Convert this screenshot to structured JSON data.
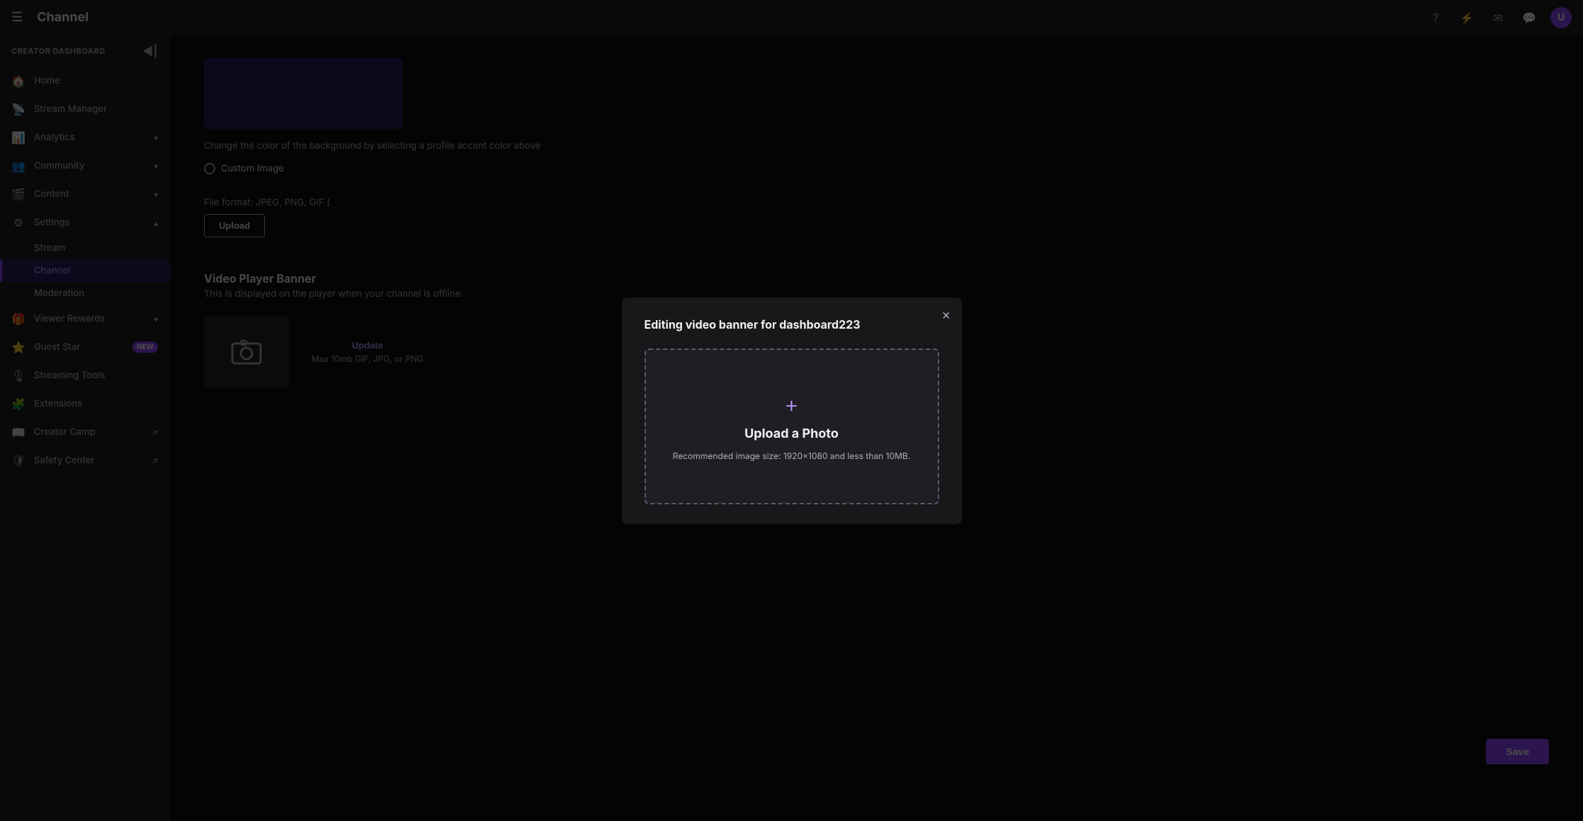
{
  "topNav": {
    "hamburger": "☰",
    "title": "Channel",
    "icons": [
      "?",
      "⚡",
      "✉",
      "💬"
    ],
    "avatarText": "U"
  },
  "sidebar": {
    "header": "CREATOR DASHBOARD",
    "collapseIcon": "◀|",
    "items": [
      {
        "id": "home",
        "label": "Home",
        "icon": "🏠",
        "hasChevron": false,
        "isActive": false
      },
      {
        "id": "stream-manager",
        "label": "Stream Manager",
        "icon": "📡",
        "hasChevron": false,
        "isActive": false
      },
      {
        "id": "analytics",
        "label": "Analytics",
        "icon": "📊",
        "hasChevron": true,
        "isActive": false
      },
      {
        "id": "community",
        "label": "Community",
        "icon": "👥",
        "hasChevron": true,
        "isActive": false
      },
      {
        "id": "content",
        "label": "Content",
        "icon": "🎬",
        "hasChevron": true,
        "isActive": false
      },
      {
        "id": "settings",
        "label": "Settings",
        "icon": "⚙",
        "hasChevron": true,
        "isActive": false,
        "isOpen": true
      }
    ],
    "subItems": [
      {
        "id": "stream",
        "label": "Stream",
        "isActive": false
      },
      {
        "id": "channel",
        "label": "Channel",
        "isActive": true
      },
      {
        "id": "moderation",
        "label": "Moderation",
        "isActive": false
      }
    ],
    "bottomItems": [
      {
        "id": "viewer-rewards",
        "label": "Viewer Rewards",
        "icon": "🎁",
        "hasChevron": true,
        "isActive": false
      },
      {
        "id": "guest-star",
        "label": "Guest Star",
        "icon": "⭐",
        "hasChevron": false,
        "badge": "NEW",
        "isActive": false
      },
      {
        "id": "streaming-tools",
        "label": "Streaming Tools",
        "icon": "🎙",
        "hasChevron": false,
        "isActive": false
      },
      {
        "id": "extensions",
        "label": "Extensions",
        "icon": "🧩",
        "hasChevron": false,
        "isActive": false
      },
      {
        "id": "creator-camp",
        "label": "Creator Camp",
        "icon": "🔗",
        "hasChevron": false,
        "external": true,
        "isActive": false
      },
      {
        "id": "safety-center",
        "label": "Safety Center",
        "icon": "🛡",
        "hasChevron": false,
        "external": true,
        "isActive": false
      }
    ]
  },
  "content": {
    "colorPreviewBg": "#2d1b5e",
    "hintText": "Change the color of the background by selecting a profile accent color above",
    "customImageLabel": "Custom Image",
    "fileFormatText": "File format: JPEG, PNG, GIF (",
    "uploadButtonLabel": "Upload",
    "videoPlayerSection": {
      "title": "Video Player Banner",
      "subtitle": "This is displayed on the player when your channel is offline.",
      "updateButtonLabel": "Update",
      "maxSizeText": "Max 10mb GIF, JPG, or PNG"
    },
    "saveButtonLabel": "Save"
  },
  "modal": {
    "title": "Editing video banner for dashboard223",
    "closeIcon": "×",
    "dropArea": {
      "plusIcon": "+",
      "uploadText": "Upload a Photo",
      "recommendedText": "Recommended image size: 1920×1080 and less\nthan 10MB."
    }
  }
}
